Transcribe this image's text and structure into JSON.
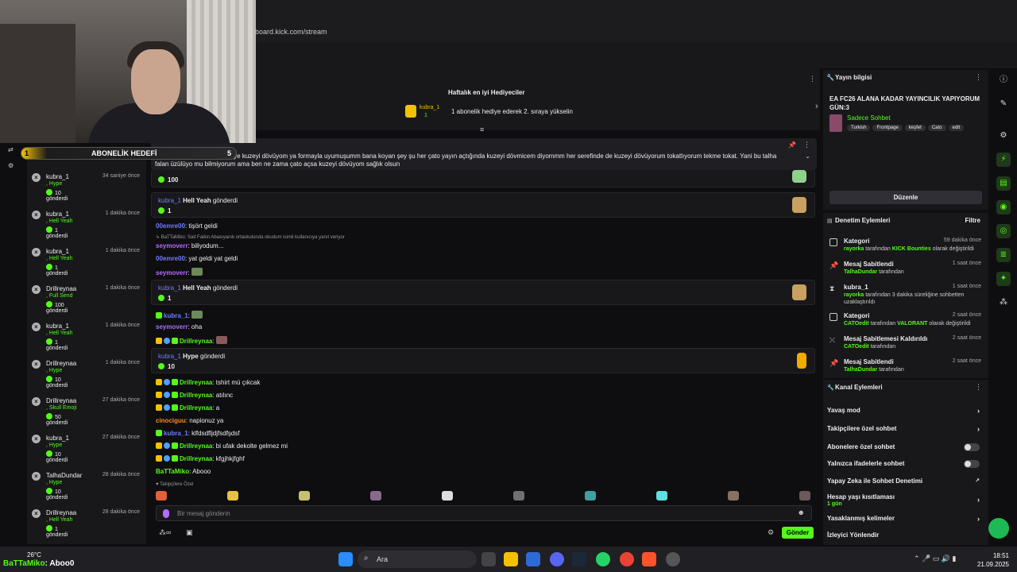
{
  "browser": {
    "url": "board.kick.com/stream"
  },
  "goal": {
    "label": "ABONELİK HEDEFİ",
    "left": "1",
    "right": "5"
  },
  "left_panel": {
    "items": [
      {
        "user": "kubra_1",
        "time": "34 saniye önce",
        "kind": ", Hype",
        "count": "10",
        "suffix": "gönderdi"
      },
      {
        "user": "kubra_1",
        "time": "1 dakika önce",
        "kind": ", Hell Yeah",
        "count": "1",
        "suffix": "gönderdi"
      },
      {
        "user": "kubra_1",
        "time": "1 dakika önce",
        "kind": ", Hell Yeah",
        "count": "1",
        "suffix": "gönderdi"
      },
      {
        "user": "Drillreynaa",
        "time": "1 dakika önce",
        "kind": ", Full Send",
        "count": "100",
        "suffix": "gönderdi"
      },
      {
        "user": "kubra_1",
        "time": "1 dakika önce",
        "kind": ", Hell Yeah",
        "count": "1",
        "suffix": "gönderdi"
      },
      {
        "user": "Drillreynaa",
        "time": "1 dakika önce",
        "kind": ", Hype",
        "count": "10",
        "suffix": "gönderdi"
      },
      {
        "user": "Drillreynaa",
        "time": "27 dakika önce",
        "kind": ", Skull Emoji",
        "count": "50",
        "suffix": "gönderdi"
      },
      {
        "user": "kubra_1",
        "time": "27 dakika önce",
        "kind": ", Hype",
        "count": "10",
        "suffix": "gönderdi"
      },
      {
        "user": "TalhaDundar",
        "time": "28 dakika önce",
        "kind": ", Hype",
        "count": "10",
        "suffix": "gönderdi"
      },
      {
        "user": "Drillreynaa",
        "time": "28 dakika önce",
        "kind": ", Hell Yeah",
        "count": "1",
        "suffix": "gönderdi"
      }
    ]
  },
  "chat": {
    "gifters_title": "Haftalık en iyi Hediyeciler",
    "top_gifter": "kubra_1",
    "top_gifter_count": "1",
    "gift_prompt": "1 abonelik hediye ederek 2. sıraya yükselin",
    "pinned_text": "kuzeyi dövmüşümm ben... yye kuzeyi dövüyom ya formayla uyumuşumm bana koyan şey şu her çato yayın açtığında kuzeyi dövmicem diyommm her serefinde de kuzeyi dövüyorum tokatlıyorum tekme tokat. Yani bu talha falan üzülüyo mu bilmiyorum ama ben ne zama çato açsa kuzeyi dövüyom sağlık olsun",
    "first_sub_count": "100",
    "sub1": {
      "user": "kubra_1",
      "what": "Hell Yeah",
      "verb": "gönderdi",
      "count": "1"
    },
    "m1": {
      "user": "00emre00",
      "text": ": tişört geldi"
    },
    "reply": "↳ BaTTaMiko: Sait Faikin Abasıyanık ortaokulunda okudum isimli kullanıcıya yanıt veriyor",
    "m2": {
      "user": "seymoverr",
      "text": ": biliyodum..."
    },
    "m3": {
      "user": "00emre00",
      "text": ": yat geldi yat geldi"
    },
    "m4": {
      "user": "seymoverr",
      "text": ":"
    },
    "sub2": {
      "user": "kubra_1",
      "what": "Hell Yeah",
      "verb": "gönderdi",
      "count": "1"
    },
    "m5": {
      "user": "kubra_1",
      "text": ":"
    },
    "m6": {
      "user": "seymoverr",
      "text": ": oha"
    },
    "m7": {
      "user": "Drillreynaa",
      "text": ":"
    },
    "sub3": {
      "user": "kubra_1",
      "what": "Hype",
      "verb": "gönderdi",
      "count": "10"
    },
    "m8": {
      "user": "Drillreynaa",
      "text": ": tshirt mü çıkcak"
    },
    "m9": {
      "user": "Drillreynaa",
      "text": ": atılınc"
    },
    "m10": {
      "user": "Drillreynaa",
      "text": ": a"
    },
    "m11": {
      "user": "cinociguu",
      "text": ": napionuz ya"
    },
    "m12": {
      "user": "kubra_1",
      "text": ": klfdsdfljdjfsdfşdsf"
    },
    "m13": {
      "user": "Drillreynaa",
      "text": ": bi ufak dekolte gelmez mi"
    },
    "m14": {
      "user": "Drillreynaa",
      "text": ": kfgjhkjfghf"
    },
    "m15": {
      "user": "BaTTaMiko",
      "text": ": Abooo"
    },
    "followers_only": "Takipçilere Özel",
    "input_placeholder": "Bir mesaj gönderin",
    "send": "Gönder"
  },
  "stream_info": {
    "header": "Yayın bilgisi",
    "title": "EA FC26 ALANA KADAR YAYINCILIK YAPIYORUM GÜN:3",
    "category": "Sadece Sohbet",
    "tags": [
      "Turkish",
      "Frontpage",
      "keşfet",
      "Cato",
      "edit"
    ],
    "edit_button": "Düzenle"
  },
  "mod_actions": {
    "header": "Denetim Eylemleri",
    "filter": "Filtre",
    "items": [
      {
        "title": "Kategori",
        "time": "59 dakika önce",
        "actor": "rayorka",
        "mid": " tarafından ",
        "target": "KICK Bounties",
        "rest": " olarak değiştirildi"
      },
      {
        "title": "Mesaj Sabitlendi",
        "time": "1 saat önce",
        "actor": "TalhaDundar",
        "mid": " tarafından",
        "target": "",
        "rest": ""
      },
      {
        "title": "kubra_1",
        "time": "1 saat önce",
        "actor": "rayorka",
        "mid": " tarafından 3 dakika süreliğine sohbetten uzaklaştırıldı",
        "target": "",
        "rest": ""
      },
      {
        "title": "Kategori",
        "time": "2 saat önce",
        "actor": "CATOedit",
        "mid": " tarafından ",
        "target": "VALORANT",
        "rest": " olarak değiştirildi"
      },
      {
        "title": "Mesaj Sabitlemesi Kaldırıldı",
        "time": "2 saat önce",
        "actor": "CATOedit",
        "mid": " tarafından",
        "target": "",
        "rest": ""
      },
      {
        "title": "Mesaj Sabitlendi",
        "time": "2 saat önce",
        "actor": "TalhaDundar",
        "mid": " tarafından",
        "target": "",
        "rest": ""
      }
    ]
  },
  "channel_actions": {
    "header": "Kanal Eylemleri",
    "slow": "Yavaş mod",
    "followers": "Takipçilere özel sohbet",
    "subs": "Abonelere özel sohbet",
    "emotes": "Yalnızca ifadelerle sohbet",
    "ai": "Yapay Zeka ile Sohbet Denetimi",
    "age": "Hesap yaşı kısıtlaması",
    "age_val": "1 gün",
    "banned": "Yasaklanmış kelimeler",
    "redirect": "İzleyici Yönlendir"
  },
  "taskbar": {
    "weather": "26°C",
    "search": "Ara",
    "time": "18:51",
    "date": "21.09.2025"
  },
  "overlay": {
    "user": "BaTTaMiko",
    "text": ": Aboo0"
  },
  "colors": {
    "accent": "#53fc18",
    "bg": "#0e0e10",
    "panel": "#18181b"
  }
}
